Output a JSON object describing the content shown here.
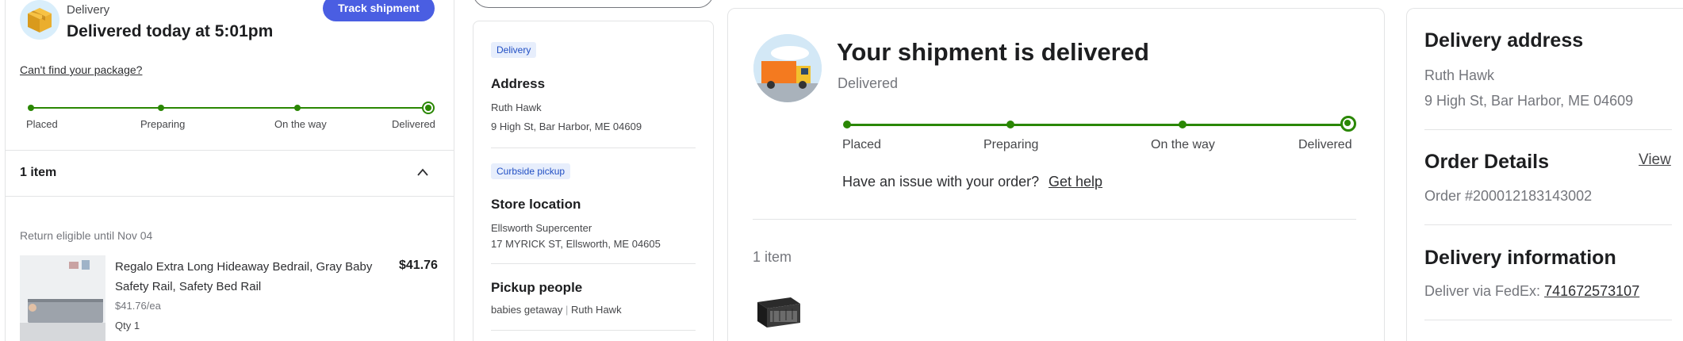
{
  "panel1": {
    "delivery_kind": "Delivery",
    "status": "Delivered today at 5:01pm",
    "track_button": "Track shipment",
    "cant_find": "Can't find your package?",
    "steps": [
      "Placed",
      "Preparing",
      "On the way",
      "Delivered"
    ],
    "items_count": "1 item",
    "return_eligible": "Return eligible until Nov 04",
    "product": {
      "name": "Regalo Extra Long Hideaway Bedrail, Gray Baby Safety Rail, Safety Bed Rail",
      "price": "$41.76",
      "unit_price": "$41.76/ea",
      "qty": "Qty 1"
    }
  },
  "panel2": {
    "delivery_tag": "Delivery",
    "address_heading": "Address",
    "address_name": "Ruth Hawk",
    "address_line": "9 High St, Bar Harbor, ME 04609",
    "pickup_tag": "Curbside pickup",
    "store_heading": "Store location",
    "store_name": "Ellsworth Supercenter",
    "store_address": "17 MYRICK ST, Ellsworth, ME 04605",
    "pickup_people_heading": "Pickup people",
    "pickup_person_1": "babies getaway",
    "separator": "|",
    "pickup_person_2": "Ruth Hawk"
  },
  "panel3": {
    "title": "Your shipment is delivered",
    "subtitle": "Delivered",
    "steps": [
      "Placed",
      "Preparing",
      "On the way",
      "Delivered"
    ],
    "issue_text": "Have an issue with your order?",
    "help_link": "Get help",
    "items_count": "1 item"
  },
  "panel4": {
    "address_heading": "Delivery address",
    "address_name": "Ruth Hawk",
    "address_line": "9 High St, Bar Harbor, ME 04609",
    "order_heading": "Order Details",
    "view_link": "View",
    "order_number": "Order #200012183143002",
    "info_heading": "Delivery information",
    "deliver_via": "Deliver via FedEx:",
    "tracking_number": "741672573107"
  },
  "colors": {
    "accent_blue": "#4a5ee2",
    "progress_green": "#2a8703",
    "tag_bg": "#e7eefc",
    "tag_text": "#214fc4"
  },
  "icons": [
    "package-icon",
    "chevron-up-icon",
    "delivery-truck-icon",
    "playard-icon"
  ]
}
